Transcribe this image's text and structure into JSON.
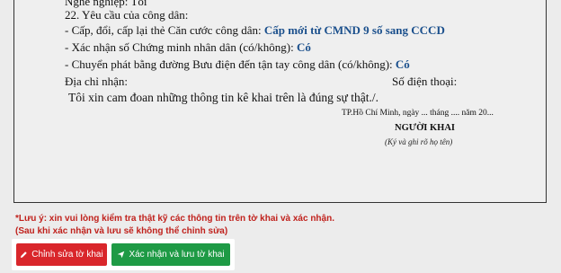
{
  "form": {
    "top_partial": "Nghề nghiệp: Tôi",
    "section_22": "22. Yêu cầu của công dân:",
    "cap_label": "- Cấp, đổi, cấp lại thẻ Căn cước công dân:",
    "cap_value": "Cấp mới từ CMND 9 số sang CCCD",
    "xac_nhan_label": "- Xác nhận số Chứng minh nhân dân (có/không):",
    "xac_nhan_value": "Có",
    "chuyen_phat_label": "- Chuyển phát bằng đường Bưu điện đến tận tay công dân (có/không):",
    "chuyen_phat_value": "Có",
    "dia_chi_label": "Địa chỉ nhận:",
    "so_dien_thoai_label": "Số điện thoại:",
    "cam_doan": "Tôi xin cam đoan những thông tin kê khai trên là đúng sự thật./.",
    "sign_place": "TP.Hồ Chí Minh, ngày ... tháng .... năm 20...",
    "sign_title": "NGƯỜI KHAI",
    "sign_hint": "(Ký và ghi rõ họ tên)"
  },
  "notice": {
    "line1": "*Lưu ý: xin vui lòng kiểm tra thật kỹ các thông tin trên tờ khai và xác nhận.",
    "line2": "(Sau khi xác nhận và lưu sẽ không thể chỉnh sửa)"
  },
  "actions": {
    "edit_label": "Chỉnh sửa tờ khai",
    "edit_icon": "pencil-icon",
    "save_label": "Xác nhận và lưu tờ khai",
    "save_icon": "send-icon"
  },
  "colors": {
    "value_text": "#1a4f8c",
    "warning_text": "#c0211c",
    "edit_button": "#d9262b",
    "save_button": "#1e9a45"
  }
}
